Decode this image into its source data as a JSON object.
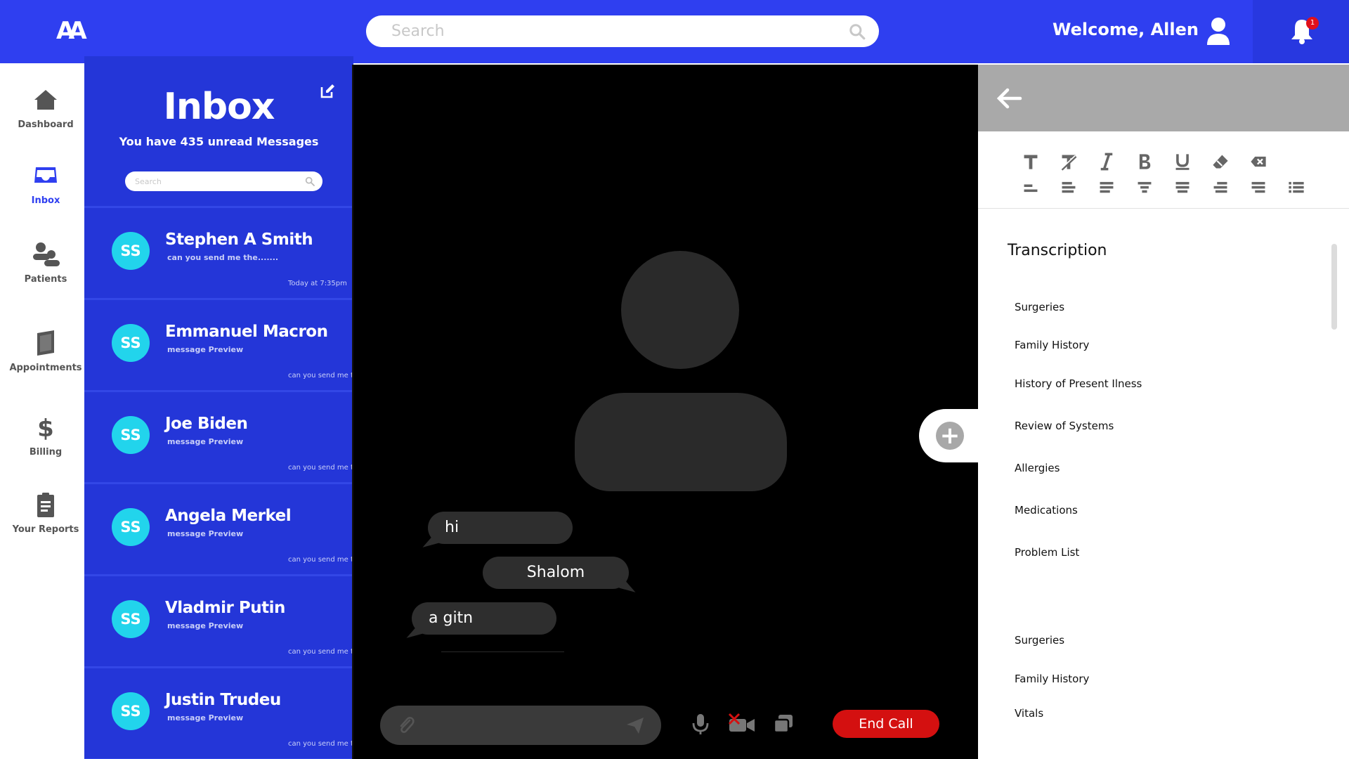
{
  "header": {
    "logo_text": "AA",
    "search_placeholder": "Search",
    "welcome": "Welcome, Allen",
    "notification_count": "1"
  },
  "nav": {
    "items": [
      {
        "label": "Dashboard",
        "icon": "home-icon"
      },
      {
        "label": "Inbox",
        "icon": "inbox-icon",
        "active": true
      },
      {
        "label": "Patients",
        "icon": "people-icon"
      },
      {
        "label": "Appointments",
        "icon": "book-icon"
      },
      {
        "label": "Billing",
        "icon": "dollar-icon"
      },
      {
        "label": "Your Reports",
        "icon": "clipboard-icon"
      }
    ]
  },
  "inbox": {
    "title": "Inbox",
    "subtitle": "You have 435 unread Messages",
    "search_placeholder": "Search",
    "messages": [
      {
        "initials": "SS",
        "name": "Stephen A Smith",
        "preview": "can you send me the.......",
        "time": "Today at 7:35pm"
      },
      {
        "initials": "SS",
        "name": "Emmanuel Macron",
        "preview": "message Preview",
        "time": "can you send me th"
      },
      {
        "initials": "SS",
        "name": "Joe Biden",
        "preview": "message Preview",
        "time": "can you send me th"
      },
      {
        "initials": "SS",
        "name": "Angela Merkel",
        "preview": "message Preview",
        "time": "can you send me th"
      },
      {
        "initials": "SS",
        "name": "Vladmir Putin",
        "preview": "message Preview",
        "time": "can you send me th"
      },
      {
        "initials": "SS",
        "name": "Justin Trudeu",
        "preview": "message Preview",
        "time": "can you send me th"
      }
    ]
  },
  "call": {
    "bubbles": [
      {
        "text": "hi",
        "direction": "in"
      },
      {
        "text": "Shalom",
        "direction": "out"
      },
      {
        "text": "a gitn",
        "direction": "in"
      }
    ],
    "end_call_label": "End Call",
    "colors": {
      "end_call": "#d41010",
      "bubble": "#2e2e2e"
    }
  },
  "transcription": {
    "title": "Transcription",
    "sections": [
      "Surgeries",
      "Family History",
      "History of Present Ilness",
      "Review of Systems",
      "Allergies",
      "Medications",
      "Problem List"
    ],
    "sections2": [
      "Surgeries",
      "Family History",
      "Vitals"
    ]
  },
  "colors": {
    "primary": "#2f3ff0",
    "inbox_bg": "#2436d8",
    "avatar": "#22d4ec",
    "badge": "#e0101a"
  }
}
